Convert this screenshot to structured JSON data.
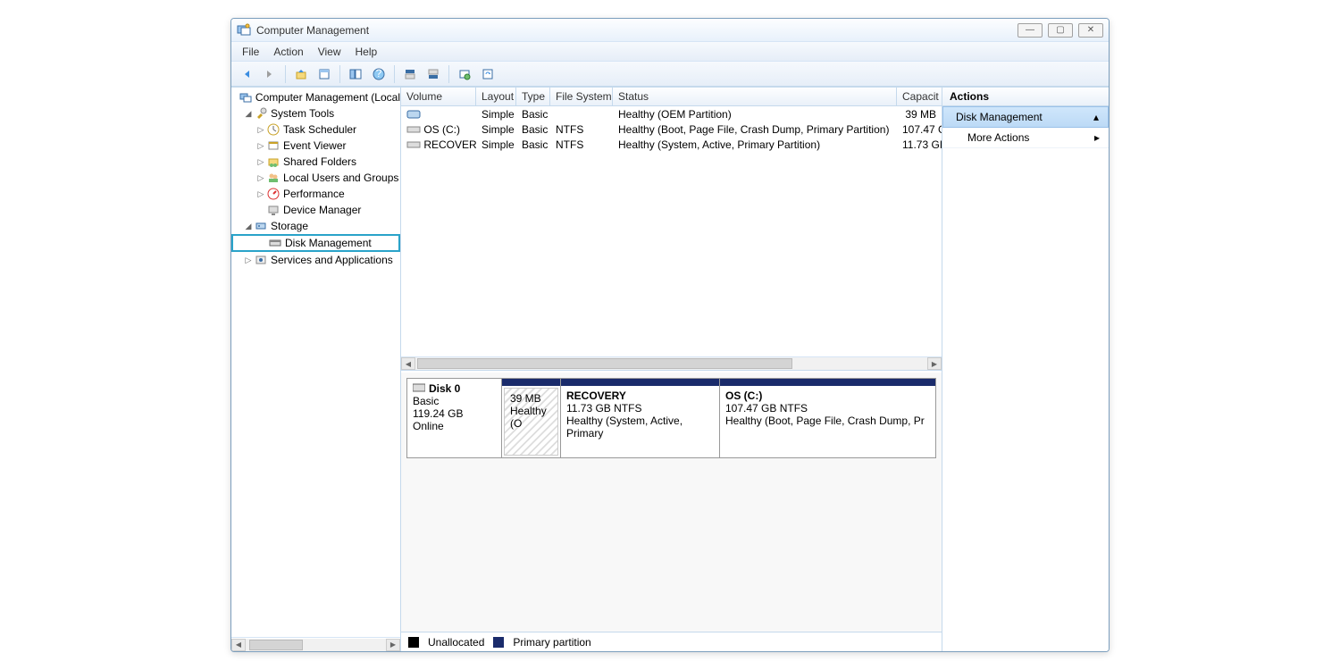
{
  "window": {
    "title": "Computer Management"
  },
  "menu": {
    "file": "File",
    "action": "Action",
    "view": "View",
    "help": "Help"
  },
  "tree": {
    "root": "Computer Management (Local",
    "system_tools": "System Tools",
    "task_scheduler": "Task Scheduler",
    "event_viewer": "Event Viewer",
    "shared_folders": "Shared Folders",
    "local_users": "Local Users and Groups",
    "performance": "Performance",
    "device_manager": "Device Manager",
    "storage": "Storage",
    "disk_management": "Disk Management",
    "services": "Services and Applications"
  },
  "vol_headers": {
    "volume": "Volume",
    "layout": "Layout",
    "type": "Type",
    "fs": "File System",
    "status": "Status",
    "capacity": "Capacit"
  },
  "volumes": [
    {
      "name": "",
      "layout": "Simple",
      "type": "Basic",
      "fs": "",
      "status": "Healthy (OEM Partition)",
      "capacity": "39 MB"
    },
    {
      "name": "OS (C:)",
      "layout": "Simple",
      "type": "Basic",
      "fs": "NTFS",
      "status": "Healthy (Boot, Page File, Crash Dump, Primary Partition)",
      "capacity": "107.47 G"
    },
    {
      "name": "RECOVERY",
      "layout": "Simple",
      "type": "Basic",
      "fs": "NTFS",
      "status": "Healthy (System, Active, Primary Partition)",
      "capacity": "11.73 GI"
    }
  ],
  "disk": {
    "label": "Disk 0",
    "type": "Basic",
    "size": "119.24 GB",
    "state": "Online",
    "parts": [
      {
        "title": "",
        "line1": "39 MB",
        "line2": "Healthy (O"
      },
      {
        "title": "RECOVERY",
        "line1": "11.73 GB NTFS",
        "line2": "Healthy (System, Active, Primary"
      },
      {
        "title": "OS  (C:)",
        "line1": "107.47 GB NTFS",
        "line2": "Healthy (Boot, Page File, Crash Dump, Pr"
      }
    ]
  },
  "legend": {
    "unalloc": "Unallocated",
    "primary": "Primary partition"
  },
  "actions": {
    "head": "Actions",
    "dm": "Disk Management",
    "more": "More Actions"
  }
}
